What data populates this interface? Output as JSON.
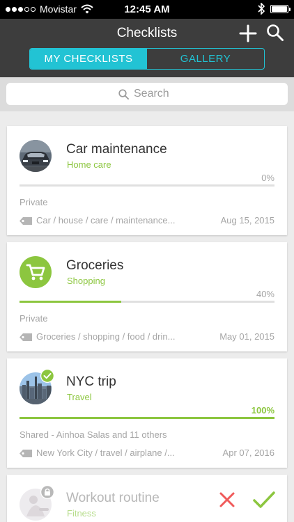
{
  "status_bar": {
    "carrier": "Movistar",
    "time": "12:45 AM",
    "battery_level": 1.0
  },
  "header": {
    "title": "Checklists",
    "add_icon": "plus-icon",
    "search_icon": "search-icon"
  },
  "tabs": [
    {
      "label": "MY CHECKLISTS",
      "active": true
    },
    {
      "label": "GALLERY",
      "active": false
    }
  ],
  "search": {
    "placeholder": "Search",
    "value": ""
  },
  "checklists": [
    {
      "title": "Car maintenance",
      "category": "Home care",
      "percent": "0%",
      "progress": 0.0,
      "privacy": "Private",
      "tags": "Car / house / care / maintenance...",
      "date": "Aug 15, 2015",
      "avatar": "car-photo"
    },
    {
      "title": "Groceries",
      "category": "Shopping",
      "percent": "40%",
      "progress": 0.4,
      "privacy": "Private",
      "tags": "Groceries / shopping / food / drin...",
      "date": "May 01, 2015",
      "avatar": "shopping-cart-icon"
    },
    {
      "title": "NYC trip",
      "category": "Travel",
      "percent": "100%",
      "progress": 1.0,
      "privacy": "Shared - Ainhoa Salas and 11 others",
      "tags": "New York City / travel / airplane /...",
      "date": "Apr 07, 2016",
      "avatar": "city-skyline-photo"
    },
    {
      "title": "Workout routine",
      "category": "Fitness",
      "avatar": "workout-photo"
    }
  ],
  "colors": {
    "accent": "#22c3d4",
    "green": "#8cc63f",
    "header_bg": "#3d3d3d",
    "reject_red": "#f05a5a"
  }
}
